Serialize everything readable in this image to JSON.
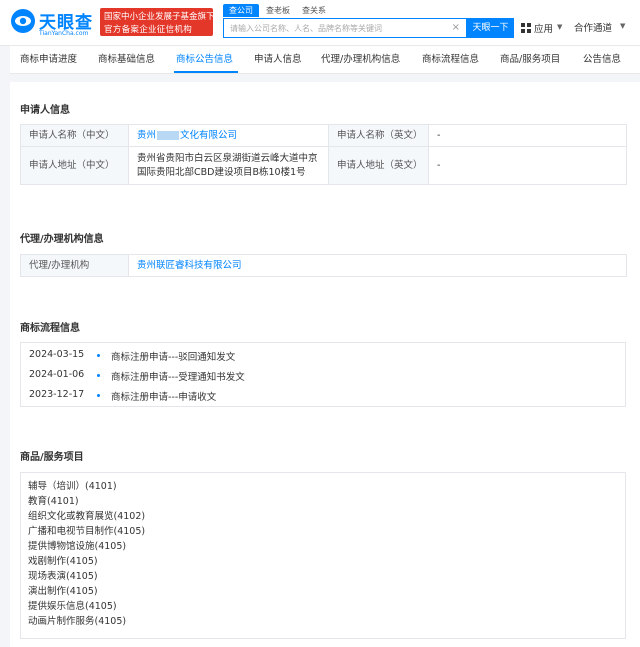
{
  "header": {
    "logo_text": "天眼查",
    "logo_sub": "TianYanCha.com",
    "badge_line1": "国家中小企业发展子基金旗下",
    "badge_line2": "官方备案企业征信机构",
    "search_tabs": [
      "查公司",
      "查老板",
      "查关系"
    ],
    "search_placeholder": "请输入公司名称、人名、品牌名称等关键词",
    "search_button": "天眼一下",
    "apps_label": "应用",
    "hezuo_label": "合作通道",
    "accent_color": "#0084ff",
    "badge_color": "#e3372a"
  },
  "tabs": [
    "商标申请进度",
    "商标基础信息",
    "商标公告信息",
    "申请人信息",
    "代理/办理机构信息",
    "商标流程信息",
    "商品/服务项目",
    "公告信息"
  ],
  "active_tab": "商标公告信息",
  "applicant": {
    "section_title": "申请人信息",
    "name_cn_label": "申请人名称（中文）",
    "name_cn_prefix": "贵州",
    "name_cn_suffix": "文化有限公司",
    "name_en_label": "申请人名称（英文）",
    "name_en_value": "-",
    "addr_cn_label": "申请人地址（中文）",
    "addr_cn_line1": "贵州省贵阳市白云区泉湖街道云峰大道中京",
    "addr_cn_line2": "国际贵阳北部CBD建设项目B栋10楼1号",
    "addr_en_label": "申请人地址（英文）",
    "addr_en_value": "-"
  },
  "agency": {
    "section_title": "代理/办理机构信息",
    "label": "代理/办理机构",
    "value": "贵州联匠睿科技有限公司"
  },
  "process": {
    "section_title": "商标流程信息",
    "items": [
      {
        "date": "2024-03-15",
        "text": "商标注册申请---驳回通知发文"
      },
      {
        "date": "2024-01-06",
        "text": "商标注册申请---受理通知书发文"
      },
      {
        "date": "2023-12-17",
        "text": "商标注册申请---申请收文"
      }
    ]
  },
  "goods": {
    "section_title": "商品/服务项目",
    "items": [
      "辅导（培训）(4101)",
      "教育(4101)",
      "组织文化或教育展览(4102)",
      "广播和电视节目制作(4105)",
      "提供博物馆设施(4105)",
      "戏剧制作(4105)",
      "现场表演(4105)",
      "演出制作(4105)",
      "提供娱乐信息(4105)",
      "动画片制作服务(4105)"
    ]
  }
}
